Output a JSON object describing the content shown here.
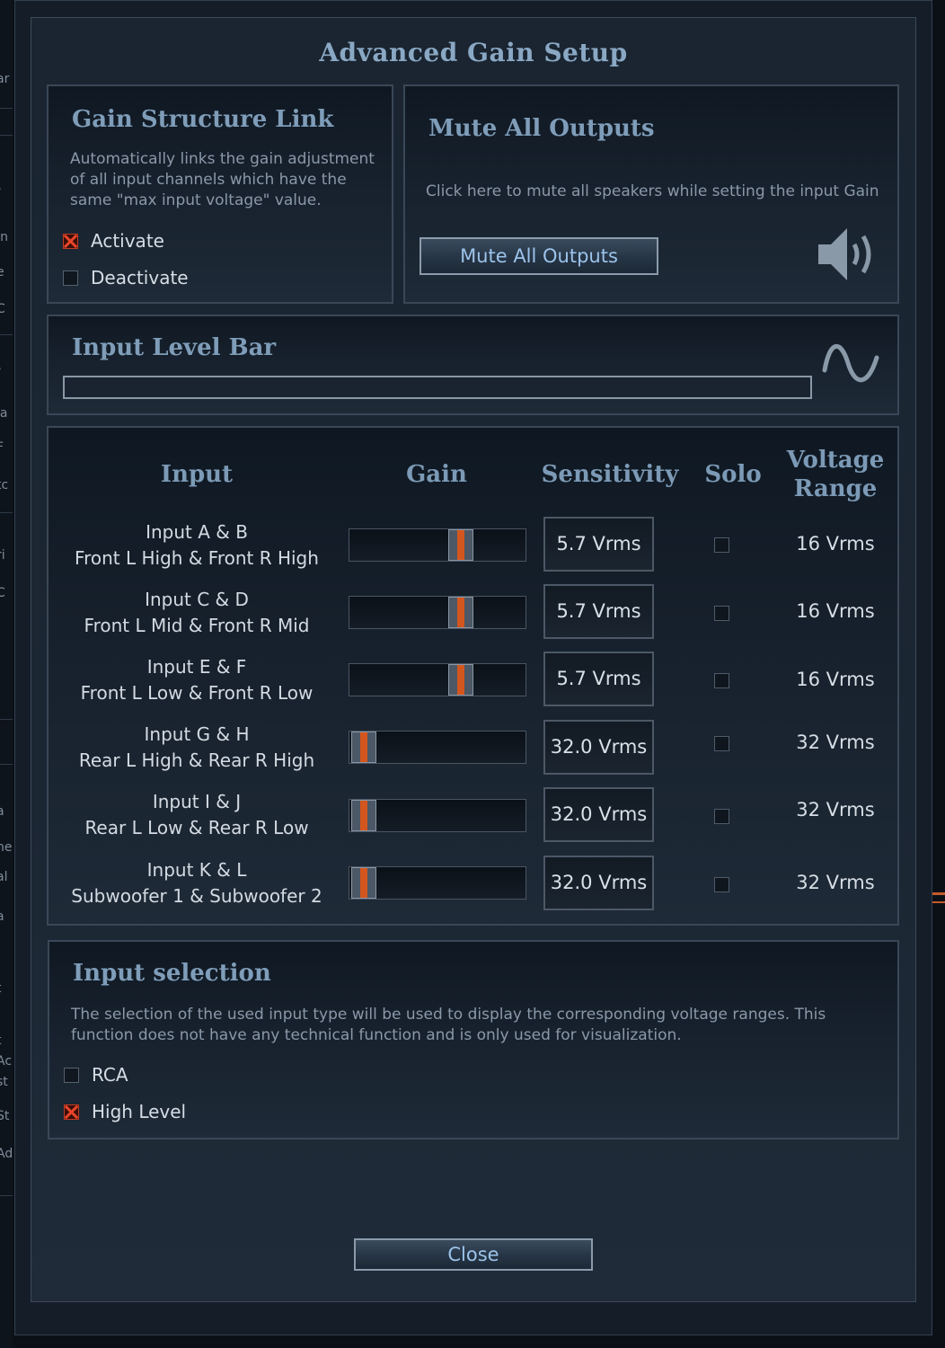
{
  "background_app": {
    "fragments": [
      "ar",
      "/",
      "In",
      "e",
      "C",
      "/ ",
      "ia",
      "F",
      "tc",
      "ri",
      "C",
      "a",
      "ne",
      "al",
      "a",
      "t",
      "t",
      "Ac",
      "st",
      "St",
      "Ad"
    ]
  },
  "dialog": {
    "title": "Advanced Gain Setup",
    "gain_link": {
      "title": "Gain Structure Link",
      "description_lines": [
        "Automatically links the gain adjustment",
        "of all input channels which have the",
        "same \"max input voltage\" value."
      ],
      "options": [
        {
          "label": "Activate",
          "checked": true
        },
        {
          "label": "Deactivate",
          "checked": false
        }
      ]
    },
    "mute": {
      "title": "Mute All Outputs",
      "description": "Click here to mute all speakers while setting the input Gain",
      "button_label": "Mute All Outputs",
      "icon": "speaker-icon"
    },
    "level_bar": {
      "title": "Input Level Bar",
      "level": 0,
      "icon": "sine-wave-icon"
    },
    "table": {
      "headers": {
        "input": "Input",
        "gain": "Gain",
        "sensitivity": "Sensitivity",
        "solo": "Solo",
        "voltage_range_line1": "Voltage",
        "voltage_range_line2": "Range"
      },
      "rows": [
        {
          "line1": "Input A & B",
          "line2": "Front L High & Front R High",
          "gain_level": 0.66,
          "sensitivity": "5.7 Vrms",
          "solo": false,
          "voltage_range": "16 Vrms"
        },
        {
          "line1": "Input C & D",
          "line2": "Front L Mid & Front R Mid",
          "gain_level": 0.66,
          "sensitivity": "5.7 Vrms",
          "solo": false,
          "voltage_range": "16 Vrms"
        },
        {
          "line1": "Input E & F",
          "line2": "Front L Low & Front R Low",
          "gain_level": 0.66,
          "sensitivity": "5.7 Vrms",
          "solo": false,
          "voltage_range": "16 Vrms"
        },
        {
          "line1": "Input G & H",
          "line2": "Rear L High & Rear R High",
          "gain_level": 0.0,
          "sensitivity": "32.0 Vrms",
          "solo": false,
          "voltage_range": "32 Vrms"
        },
        {
          "line1": "Input I & J",
          "line2": "Rear L Low & Rear R Low",
          "gain_level": 0.0,
          "sensitivity": "32.0 Vrms",
          "solo": false,
          "voltage_range": "32 Vrms"
        },
        {
          "line1": "Input K & L",
          "line2": "Subwoofer 1 & Subwoofer 2",
          "gain_level": 0.0,
          "sensitivity": "32.0 Vrms",
          "solo": false,
          "voltage_range": "32 Vrms"
        }
      ]
    },
    "input_selection": {
      "title": "Input selection",
      "description_lines": [
        "The selection of the used input type will be used to display the corresponding voltage ranges. This",
        "function does not have any technical function and is only used for visualization."
      ],
      "options": [
        {
          "label": "RCA",
          "checked": false
        },
        {
          "label": "High Level",
          "checked": true
        }
      ]
    },
    "close_label": "Close"
  },
  "colors": {
    "accent_orange": "#d4561f",
    "check_red": "#e8452a",
    "title_blue": "#8aa8c4",
    "button_text": "#9cc3ea"
  }
}
